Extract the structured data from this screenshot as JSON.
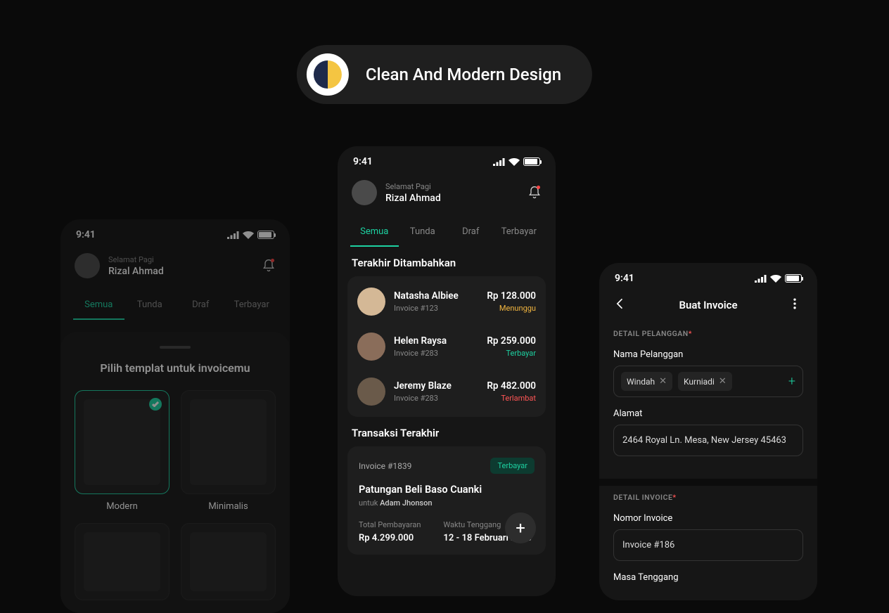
{
  "header": {
    "title": "Clean And Modern Design"
  },
  "statusTime": "9:41",
  "greeting": "Selamat Pagi",
  "userName": "Rizal Ahmad",
  "tabs": [
    "Semua",
    "Tunda",
    "Draf",
    "Terbayar"
  ],
  "phone1": {
    "title": "Pilih templat untuk invoicemu",
    "templates": [
      "Modern",
      "Minimalis"
    ]
  },
  "phone2": {
    "recentTitle": "Terakhir Ditambahkan",
    "invoices": [
      {
        "name": "Natasha Albiee",
        "sub": "Invoice #123",
        "amount": "Rp 128.000",
        "status": "Menunggu",
        "cls": "st-pending"
      },
      {
        "name": "Helen Raysa",
        "sub": "Invoice #283",
        "amount": "Rp 259.000",
        "status": "Terbayar",
        "cls": "st-paid"
      },
      {
        "name": "Jeremy Blaze",
        "sub": "Invoice #283",
        "amount": "Rp 482.000",
        "status": "Terlambat",
        "cls": "st-late"
      }
    ],
    "trxTitle": "Transaksi Terakhir",
    "trx": {
      "id": "Invoice #1839",
      "badge": "Terbayar",
      "title": "Patungan Beli Baso Cuanki",
      "forPrefix": "untuk ",
      "forName": "Adam Jhonson",
      "totalLabel": "Total Pembayaran",
      "totalValue": "Rp 4.299.000",
      "dueLabel": "Waktu Tenggang",
      "dueValue": "12 - 18 Februari 2023"
    }
  },
  "phone3": {
    "navTitle": "Buat Invoice",
    "custSection": "DETAIL PELANGGAN",
    "custNameLabel": "Nama Pelanggan",
    "chips": [
      "Windah",
      "Kurniadi"
    ],
    "addressLabel": "Alamat",
    "addressValue": "2464 Royal Ln. Mesa, New Jersey 45463",
    "invSection": "DETAIL INVOICE",
    "invNumLabel": "Nomor Invoice",
    "invNumValue": "Invoice #186",
    "dueLabel": "Masa Tenggang"
  }
}
